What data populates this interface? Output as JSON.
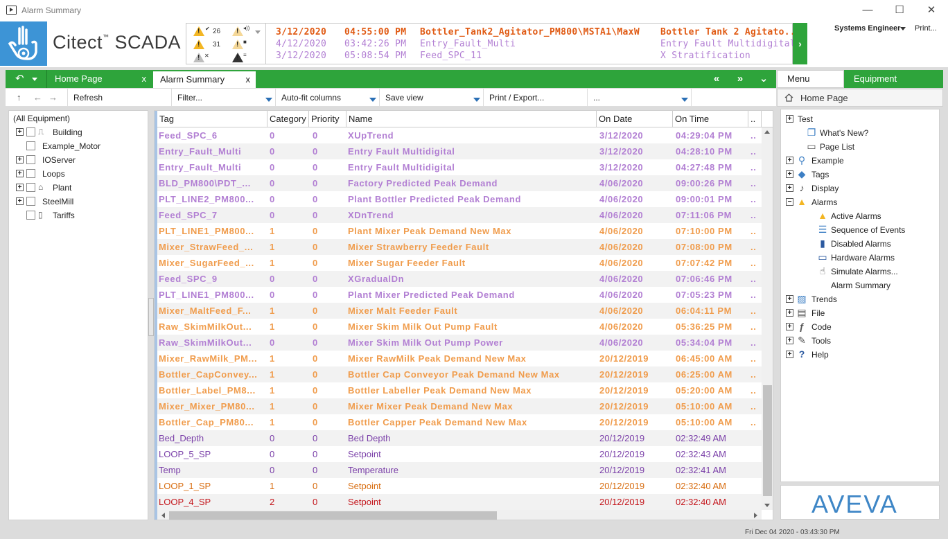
{
  "window": {
    "title": "Alarm Summary",
    "minimize": "—",
    "maximize": "☐",
    "close": "✕"
  },
  "brand": {
    "name": "Citect",
    "tm": "™",
    "suffix": "SCADA"
  },
  "alarm_counts": {
    "unacked_high": "26",
    "active": "31"
  },
  "ticker": [
    {
      "date": "3/12/2020",
      "time": "04:55:00 PM",
      "tag": "Bottler_Tank2_Agitator_PM800\\MSTA1\\MaxW",
      "desc": "Bottler Tank 2 Agitato...",
      "style": "orange"
    },
    {
      "date": "4/12/2020",
      "time": "03:42:26 PM",
      "tag": "Entry_Fault_Multi",
      "desc": "Entry Fault Multidigital",
      "style": "purple"
    },
    {
      "date": "3/12/2020",
      "time": "05:08:54 PM",
      "tag": "Feed_SPC_11",
      "desc": "X Stratification",
      "style": "purple"
    }
  ],
  "user": {
    "name": "Systems Engineer",
    "print": "Print..."
  },
  "tabs": {
    "home": "Home Page",
    "alarm": "Alarm Summary",
    "close": "x",
    "prev": "«",
    "next": "»",
    "more": "⌄"
  },
  "side_tabs": {
    "menu": "Menu",
    "equipment": "Equipment"
  },
  "toolbar": {
    "refresh": "Refresh",
    "filter": "Filter...",
    "autofit": "Auto-fit columns",
    "saveview": "Save view",
    "print": "Print / Export...",
    "more": "..."
  },
  "tree": {
    "root": "(All Equipment)",
    "items": [
      {
        "label": "Building",
        "expand": true,
        "icon": "building-icon"
      },
      {
        "label": "Example_Motor",
        "expand": false,
        "icon": ""
      },
      {
        "label": "IOServer",
        "expand": true,
        "icon": ""
      },
      {
        "label": "Loops",
        "expand": true,
        "icon": ""
      },
      {
        "label": "Plant",
        "expand": true,
        "icon": "plant-icon"
      },
      {
        "label": "SteelMill",
        "expand": true,
        "icon": ""
      },
      {
        "label": "Tariffs",
        "expand": false,
        "icon": "tariffs-icon"
      }
    ]
  },
  "grid": {
    "columns": [
      "Tag",
      "Category",
      "Priority",
      "Name",
      "On Date",
      "On Time",
      ".."
    ],
    "rows": [
      {
        "tag": "Feed_SPC_6",
        "cat": "0",
        "pri": "0",
        "name": "XUpTrend",
        "date": "3/12/2020",
        "time": "04:29:04 PM",
        "more": "..",
        "style": "bold",
        "color": "purple"
      },
      {
        "tag": "Entry_Fault_Multi",
        "cat": "0",
        "pri": "0",
        "name": "Entry Fault Multidigital",
        "date": "3/12/2020",
        "time": "04:28:10 PM",
        "more": "..",
        "style": "bold",
        "color": "purple"
      },
      {
        "tag": "Entry_Fault_Multi",
        "cat": "0",
        "pri": "0",
        "name": "Entry Fault Multidigital",
        "date": "3/12/2020",
        "time": "04:27:48 PM",
        "more": "..",
        "style": "bold",
        "color": "purple"
      },
      {
        "tag": "BLD_PM800\\PDT_...",
        "cat": "0",
        "pri": "0",
        "name": "Factory Predicted Peak Demand",
        "date": "4/06/2020",
        "time": "09:00:26 PM",
        "more": "..",
        "style": "bold",
        "color": "purple"
      },
      {
        "tag": "PLT_LINE2_PM800...",
        "cat": "0",
        "pri": "0",
        "name": "Plant Bottler Predicted Peak Demand",
        "date": "4/06/2020",
        "time": "09:00:01 PM",
        "more": "..",
        "style": "bold",
        "color": "purple"
      },
      {
        "tag": "Feed_SPC_7",
        "cat": "0",
        "pri": "0",
        "name": "XDnTrend",
        "date": "4/06/2020",
        "time": "07:11:06 PM",
        "more": "..",
        "style": "bold",
        "color": "purple"
      },
      {
        "tag": "PLT_LINE1_PM800...",
        "cat": "1",
        "pri": "0",
        "name": "Plant Mixer Peak Demand New Max",
        "date": "4/06/2020",
        "time": "07:10:00 PM",
        "more": "..",
        "style": "bold",
        "color": "orange"
      },
      {
        "tag": "Mixer_StrawFeed_...",
        "cat": "1",
        "pri": "0",
        "name": "Mixer Strawberry Feeder Fault",
        "date": "4/06/2020",
        "time": "07:08:00 PM",
        "more": "..",
        "style": "bold",
        "color": "orange"
      },
      {
        "tag": "Mixer_SugarFeed_...",
        "cat": "1",
        "pri": "0",
        "name": "Mixer Sugar Feeder Fault",
        "date": "4/06/2020",
        "time": "07:07:42 PM",
        "more": "..",
        "style": "bold",
        "color": "orange"
      },
      {
        "tag": "Feed_SPC_9",
        "cat": "0",
        "pri": "0",
        "name": "XGradualDn",
        "date": "4/06/2020",
        "time": "07:06:46 PM",
        "more": "..",
        "style": "bold",
        "color": "purple"
      },
      {
        "tag": "PLT_LINE1_PM800...",
        "cat": "0",
        "pri": "0",
        "name": "Plant Mixer Predicted Peak Demand",
        "date": "4/06/2020",
        "time": "07:05:23 PM",
        "more": "..",
        "style": "bold",
        "color": "purple"
      },
      {
        "tag": "Mixer_MaltFeed_F...",
        "cat": "1",
        "pri": "0",
        "name": "Mixer Malt Feeder Fault",
        "date": "4/06/2020",
        "time": "06:04:11 PM",
        "more": "..",
        "style": "bold",
        "color": "orange"
      },
      {
        "tag": "Raw_SkimMilkOut...",
        "cat": "1",
        "pri": "0",
        "name": "Mixer Skim Milk Out Pump Fault",
        "date": "4/06/2020",
        "time": "05:36:25 PM",
        "more": "..",
        "style": "bold",
        "color": "orange"
      },
      {
        "tag": "Raw_SkimMilkOut...",
        "cat": "0",
        "pri": "0",
        "name": "Mixer Skim Milk Out Pump Power",
        "date": "4/06/2020",
        "time": "05:34:04 PM",
        "more": "..",
        "style": "bold",
        "color": "purple"
      },
      {
        "tag": "Mixer_RawMilk_PM...",
        "cat": "1",
        "pri": "0",
        "name": "Mixer RawMilk Peak Demand New Max",
        "date": "20/12/2019",
        "time": "06:45:00 AM",
        "more": "..",
        "style": "bold",
        "color": "orange"
      },
      {
        "tag": "Bottler_CapConvey...",
        "cat": "1",
        "pri": "0",
        "name": "Bottler Cap Conveyor Peak Demand New Max",
        "date": "20/12/2019",
        "time": "06:25:00 AM",
        "more": "..",
        "style": "bold",
        "color": "orange"
      },
      {
        "tag": "Bottler_Label_PM8...",
        "cat": "1",
        "pri": "0",
        "name": "Bottler Labeller Peak Demand New Max",
        "date": "20/12/2019",
        "time": "05:20:00 AM",
        "more": "..",
        "style": "bold",
        "color": "orange"
      },
      {
        "tag": "Mixer_Mixer_PM80...",
        "cat": "1",
        "pri": "0",
        "name": "Mixer Mixer Peak Demand New Max",
        "date": "20/12/2019",
        "time": "05:10:00 AM",
        "more": "..",
        "style": "bold",
        "color": "orange"
      },
      {
        "tag": "Bottler_Cap_PM80...",
        "cat": "1",
        "pri": "0",
        "name": "Bottler Capper Peak Demand New Max",
        "date": "20/12/2019",
        "time": "05:10:00 AM",
        "more": "..",
        "style": "bold",
        "color": "orange"
      },
      {
        "tag": "Bed_Depth",
        "cat": "0",
        "pri": "0",
        "name": "Bed Depth",
        "date": "20/12/2019",
        "time": "02:32:49 AM",
        "more": "",
        "style": "norm",
        "color": "darkpurple"
      },
      {
        "tag": "LOOP_5_SP",
        "cat": "0",
        "pri": "0",
        "name": "Setpoint",
        "date": "20/12/2019",
        "time": "02:32:43 AM",
        "more": "",
        "style": "norm",
        "color": "darkpurple"
      },
      {
        "tag": "Temp",
        "cat": "0",
        "pri": "0",
        "name": "Temperature",
        "date": "20/12/2019",
        "time": "02:32:41 AM",
        "more": "",
        "style": "norm",
        "color": "darkpurple"
      },
      {
        "tag": "LOOP_1_SP",
        "cat": "1",
        "pri": "0",
        "name": "Setpoint",
        "date": "20/12/2019",
        "time": "02:32:40 AM",
        "more": "",
        "style": "norm",
        "color": "darkorange"
      },
      {
        "tag": "LOOP_4_SP",
        "cat": "2",
        "pri": "0",
        "name": "Setpoint",
        "date": "20/12/2019",
        "time": "02:32:40 AM",
        "more": "",
        "style": "norm",
        "color": "red"
      }
    ]
  },
  "menu": {
    "home": "Home Page",
    "items": [
      {
        "label": "Test",
        "level": 0,
        "expand": "+",
        "icon": ""
      },
      {
        "label": "What's New?",
        "level": 1,
        "expand": "",
        "icon": "whats-new-icon"
      },
      {
        "label": "Page List",
        "level": 1,
        "expand": "",
        "icon": "page-list-icon"
      },
      {
        "label": "Example",
        "level": 0,
        "expand": "+",
        "icon": "search-icon"
      },
      {
        "label": "Tags",
        "level": 0,
        "expand": "+",
        "icon": "tag-icon"
      },
      {
        "label": "Display",
        "level": 0,
        "expand": "+",
        "icon": "display-icon"
      },
      {
        "label": "Alarms",
        "level": 0,
        "expand": "−",
        "icon": "alarm-icon"
      },
      {
        "label": "Active Alarms",
        "level": 2,
        "expand": "",
        "icon": "active-alarms-icon"
      },
      {
        "label": "Sequence of Events",
        "level": 2,
        "expand": "",
        "icon": "sequence-icon"
      },
      {
        "label": "Disabled Alarms",
        "level": 2,
        "expand": "",
        "icon": "disabled-alarms-icon"
      },
      {
        "label": "Hardware Alarms",
        "level": 2,
        "expand": "",
        "icon": "hardware-alarms-icon"
      },
      {
        "label": "Simulate Alarms...",
        "level": 2,
        "expand": "",
        "icon": "simulate-alarms-icon"
      },
      {
        "label": "Alarm Summary",
        "level": 2,
        "expand": "",
        "icon": ""
      },
      {
        "label": "Trends",
        "level": 0,
        "expand": "+",
        "icon": "trends-icon"
      },
      {
        "label": "File",
        "level": 0,
        "expand": "+",
        "icon": "file-icon"
      },
      {
        "label": "Code",
        "level": 0,
        "expand": "+",
        "icon": "code-icon"
      },
      {
        "label": "Tools",
        "level": 0,
        "expand": "+",
        "icon": "tools-icon"
      },
      {
        "label": "Help",
        "level": 0,
        "expand": "+",
        "icon": "help-icon"
      }
    ]
  },
  "vendor": "AVEVA",
  "status": {
    "datetime": "Fri Dec 04 2020 - 03:43:30 PM"
  },
  "colors": {
    "accent": "#2ea43b",
    "brand_blue": "#3d94d6",
    "alarm_purple": "#b27fd3",
    "alarm_orange": "#f09c4c",
    "alarm_red": "#c4171d"
  }
}
